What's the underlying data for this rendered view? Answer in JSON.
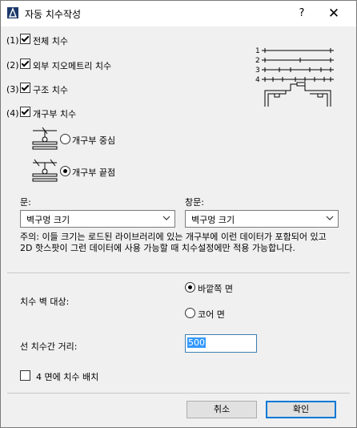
{
  "window": {
    "title": "자동 치수작성",
    "help": "?",
    "close": "✕"
  },
  "options": [
    {
      "num": "(1)",
      "label": "전체 치수"
    },
    {
      "num": "(2)",
      "label": "외부 지오메트리 치수"
    },
    {
      "num": "(3)",
      "label": "구조 치수"
    },
    {
      "num": "(4)",
      "label": "개구부 치수"
    }
  ],
  "preview_numbers": [
    "1",
    "2",
    "3",
    "4"
  ],
  "opening_mode": {
    "center": "개구부 중심",
    "edges": "개구부 끝점"
  },
  "door": {
    "label": "문:",
    "value": "벽구멍 크기"
  },
  "window_opening": {
    "label": "창문:",
    "value": "벽구멍 크기"
  },
  "note": "주의: 이들 크기는 로드된 라이브러리에 있는 개구부에 이런 데이터가 포함되어 있고 2D 핫스팟이 그런 데이터에 사용 가능할 때 치수설정에만 적용 가능합니다.",
  "wall_target": {
    "label": "치수 벽 대상:",
    "outer": "바깥쪽 면",
    "core": "코어 면"
  },
  "distance": {
    "label": "선 치수간 거리:",
    "value": "500"
  },
  "four_sides": {
    "label": "4 면에 치수 배치"
  },
  "buttons": {
    "cancel": "취소",
    "ok": "확인"
  }
}
